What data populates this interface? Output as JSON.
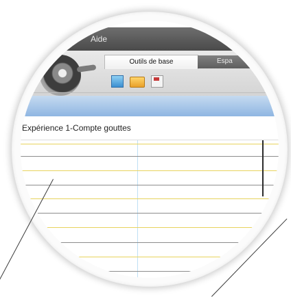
{
  "menu": {
    "aide_label": "Aide"
  },
  "ribbon": {
    "active_tab_label": "Outils de base",
    "inactive_tab_label": "Espa",
    "tools": [
      "new-document-icon",
      "open-folder-icon",
      "save-icon"
    ]
  },
  "document": {
    "title": "Expérience 1-Compte gouttes"
  },
  "colors": {
    "menubar": "#4a4a4a",
    "bluebar": "#8fb6e2",
    "grid_gray": "#8c8c8c",
    "grid_gold": "#e7d35c",
    "vertical_divider": "#bfe0f5"
  }
}
